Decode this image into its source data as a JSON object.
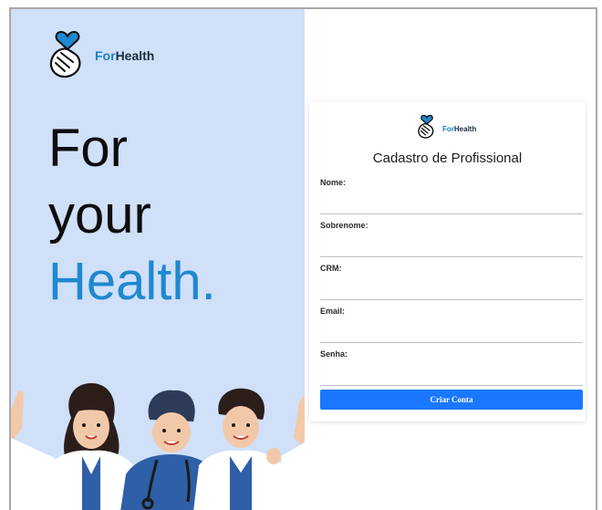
{
  "brand": {
    "prefix": "For",
    "suffix": "Health"
  },
  "hero": {
    "line1": "For",
    "line2": "your",
    "line3": "Health."
  },
  "form": {
    "title": "Cadastro de Profissional",
    "fields": [
      {
        "label": "Nome:",
        "value": ""
      },
      {
        "label": "Sobrenome:",
        "value": ""
      },
      {
        "label": "CRM:",
        "value": ""
      },
      {
        "label": "Email:",
        "value": ""
      },
      {
        "label": "Senha:",
        "value": ""
      }
    ],
    "submit_label": "Criar Conta"
  },
  "colors": {
    "hero_bg": "#cfe0f8",
    "accent": "#1f88d0",
    "button": "#1a78ff"
  },
  "icons": {
    "logo": "heart-hand-icon",
    "illustration": "doctors-illustration"
  }
}
